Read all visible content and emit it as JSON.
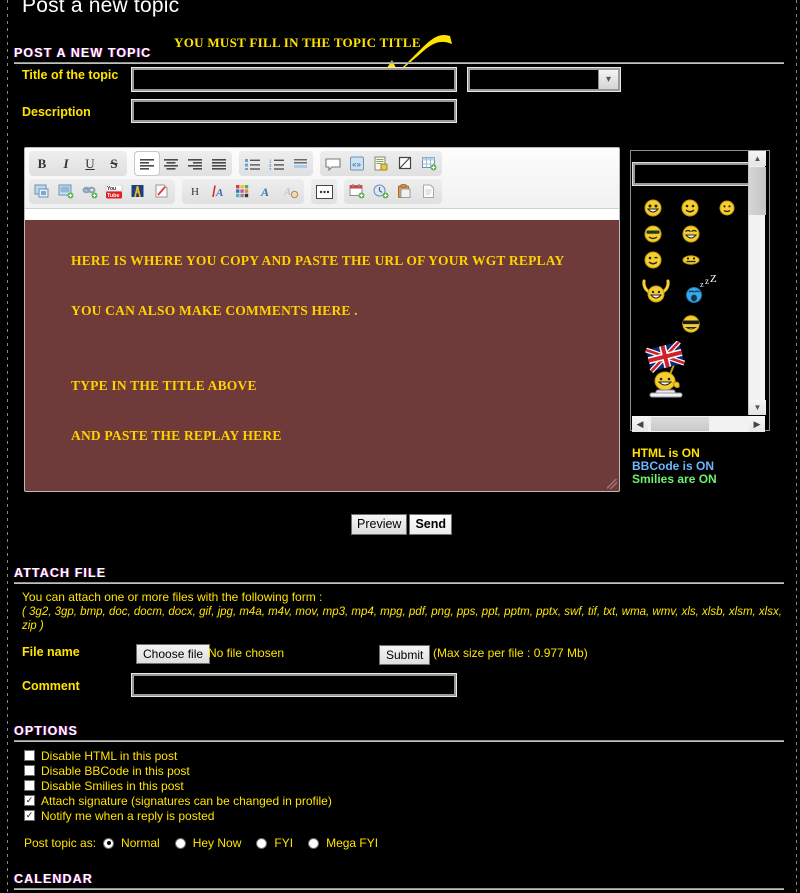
{
  "page": {
    "title": "Post a new topic"
  },
  "annotations": {
    "title_hint": "YOU MUST FILL IN THE TOPIC TITLE"
  },
  "post_section": {
    "heading": "POST A NEW TOPIC",
    "title_label": "Title of the topic",
    "title_value": "",
    "title_placeholder": "",
    "category_value": "",
    "description_label": "Description",
    "description_value": ""
  },
  "editor": {
    "toolbar_row1": [
      {
        "name": "bold",
        "glyph": "B"
      },
      {
        "name": "italic",
        "glyph": "I"
      },
      {
        "name": "underline",
        "glyph": "U"
      },
      {
        "name": "strikethrough",
        "glyph": "S"
      },
      {
        "name": "align-left",
        "glyph": ""
      },
      {
        "name": "align-center",
        "glyph": ""
      },
      {
        "name": "align-right",
        "glyph": ""
      },
      {
        "name": "align-justify",
        "glyph": ""
      },
      {
        "name": "bullet-list",
        "glyph": ""
      },
      {
        "name": "numbered-list",
        "glyph": ""
      },
      {
        "name": "indent",
        "glyph": ""
      },
      {
        "name": "quote",
        "glyph": ""
      },
      {
        "name": "code",
        "glyph": ""
      },
      {
        "name": "hidden-text",
        "glyph": ""
      },
      {
        "name": "spoiler",
        "glyph": ""
      },
      {
        "name": "table",
        "glyph": ""
      }
    ],
    "toolbar_row2": [
      {
        "name": "insert-image",
        "glyph": ""
      },
      {
        "name": "insert-media",
        "glyph": ""
      },
      {
        "name": "insert-link",
        "glyph": ""
      },
      {
        "name": "youtube",
        "glyph": "You Tube"
      },
      {
        "name": "flash",
        "glyph": ""
      },
      {
        "name": "insert-file",
        "glyph": ""
      },
      {
        "name": "heading",
        "glyph": "H"
      },
      {
        "name": "font-color",
        "glyph": "A"
      },
      {
        "name": "color-palette",
        "glyph": ""
      },
      {
        "name": "font-family",
        "glyph": "A"
      },
      {
        "name": "font-highlight",
        "glyph": "A"
      },
      {
        "name": "more-options",
        "glyph": "•••"
      },
      {
        "name": "insert-date",
        "glyph": ""
      },
      {
        "name": "insert-time",
        "glyph": ""
      },
      {
        "name": "paste",
        "glyph": ""
      },
      {
        "name": "new-page",
        "glyph": ""
      }
    ],
    "body_lines": [
      "HERE IS WHERE YOU COPY AND PASTE THE URL OF YOUR WGT REPLAY",
      "",
      "YOU CAN ALSO MAKE COMMENTS HERE .",
      "",
      "",
      "TYPE IN THE TITLE ABOVE",
      "",
      "AND PASTE THE REPLAY HERE"
    ],
    "body_text": "HERE IS WHERE YOU COPY AND PASTE THE URL OF YOUR WGT REPLAY\n\nYOU CAN ALSO MAKE COMMENTS HERE .\n\n\nTYPE IN THE TITLE ABOVE\n\nAND PASTE THE REPLAY HERE",
    "body_bg": "#6e3a3a",
    "body_color": "#ffd200"
  },
  "smilies": {
    "search_value": "",
    "rows": [
      [
        "grin-smiley",
        "smile-smiley",
        "neutral-smiley"
      ],
      [
        "cool-smiley",
        "laugh-smiley"
      ],
      [
        "wink-smiley",
        "squint-smiley"
      ],
      [
        "cheer-smiley",
        "sleep-smiley"
      ],
      [
        "sunglasses-smiley"
      ],
      [
        "uk-flag-smiley"
      ]
    ],
    "scroll_up": "▲",
    "scroll_down": "▼",
    "scroll_left": "◀",
    "scroll_right": "▶"
  },
  "status": {
    "html": "HTML is ON",
    "bbcode": "BBCode is ON",
    "smilies": "Smilies are ON",
    "html_color": "#ffe400",
    "bbcode_color": "#6fb4ff",
    "smilies_color": "#6ef06e"
  },
  "buttons": {
    "preview": "Preview",
    "send": "Send"
  },
  "attach": {
    "heading": "ATTACH FILE",
    "intro": "You can attach one or more files with the following form :",
    "extensions": "( 3g2, 3gp, bmp, doc, docm, docx, gif, jpg, m4a, m4v, mov, mp3, mp4, mpg, pdf, png, pps, ppt, pptm, pptx, swf, tif, txt, wma, wmv, xls, xlsb, xlsm, xlsx, zip )",
    "file_label": "File name",
    "choose_button": "Choose file",
    "no_file_text": "No file chosen",
    "submit_button": "Submit",
    "max_size": "(Max size per file : 0.977 Mb)",
    "comment_label": "Comment",
    "comment_value": ""
  },
  "options": {
    "heading": "OPTIONS",
    "checkboxes": [
      {
        "label": "Disable HTML in this post",
        "checked": false
      },
      {
        "label": "Disable BBCode in this post",
        "checked": false
      },
      {
        "label": "Disable Smilies in this post",
        "checked": false
      },
      {
        "label": "Attach signature (signatures can be changed in profile)",
        "checked": true
      },
      {
        "label": "Notify me when a reply is posted",
        "checked": true
      }
    ],
    "post_as_label": "Post topic as:",
    "radios": [
      {
        "label": "Normal",
        "selected": true
      },
      {
        "label": "Hey Now",
        "selected": false
      },
      {
        "label": "FYI",
        "selected": false
      },
      {
        "label": "Mega FYI",
        "selected": false
      }
    ]
  },
  "calendar": {
    "heading": "CALENDAR"
  }
}
